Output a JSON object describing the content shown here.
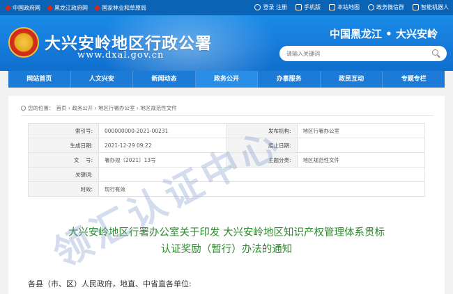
{
  "topbar": {
    "links": [
      "中国政府网",
      "黑龙江政府网",
      "国家林业和草原局"
    ],
    "tools": [
      {
        "label": "登录 注册",
        "icon": "user-icon"
      },
      {
        "label": "手机版",
        "icon": "phone-icon"
      },
      {
        "label": "本站地图",
        "icon": "sitemap-icon"
      },
      {
        "label": "政务微信群",
        "icon": "wechat-icon"
      },
      {
        "label": "智能机器人",
        "icon": "robot-icon"
      }
    ]
  },
  "header": {
    "site_title": "大兴安岭地区行政公署",
    "site_url": "www.dxal.gov.cn",
    "region": "中国黑龙江 • 大兴安岭",
    "search_placeholder": "请输入关键词"
  },
  "nav": {
    "items": [
      "网站首页",
      "人文兴安",
      "新闻动态",
      "政务公开",
      "办事服务",
      "政民互动",
      "专题专栏"
    ],
    "active_index": 3
  },
  "breadcrumb": {
    "prefix": "您的位置：",
    "path": "首页 › 政务公开 › 地区行署办公室 › 地区规范性文件"
  },
  "meta": {
    "index_label": "索引号:",
    "index_value": "000000000-2021-00231",
    "publisher_label": "发布机构:",
    "publisher_value": "地区行署办公室",
    "date_label": "生成日期:",
    "date_value": "2021-12-29 09:22",
    "abolish_label": "废止日期:",
    "abolish_value": "",
    "docno_label": "文    号:",
    "docno_value": "署办规〔2021〕13号",
    "category_label": "主题分类:",
    "category_value": "地区规范性文件",
    "keywords_label": "关键词:",
    "keywords_value": "",
    "validity_label": "时效:",
    "validity_value": "现行有效"
  },
  "document": {
    "title_line1": "大兴安岭地区行署办公室关于印发 大兴安岭地区知识产权管理体系贯标",
    "title_line2": "认证奖励（暂行）办法的通知",
    "salutation": "各县（市、区）人民政府，地直、中省直各单位:"
  },
  "watermark": "领汇认证中心",
  "colors": {
    "topbar": "#0b63b5",
    "header": "#1579d9",
    "nav": "#1c7bd6",
    "title_green": "#2d8a2d"
  }
}
